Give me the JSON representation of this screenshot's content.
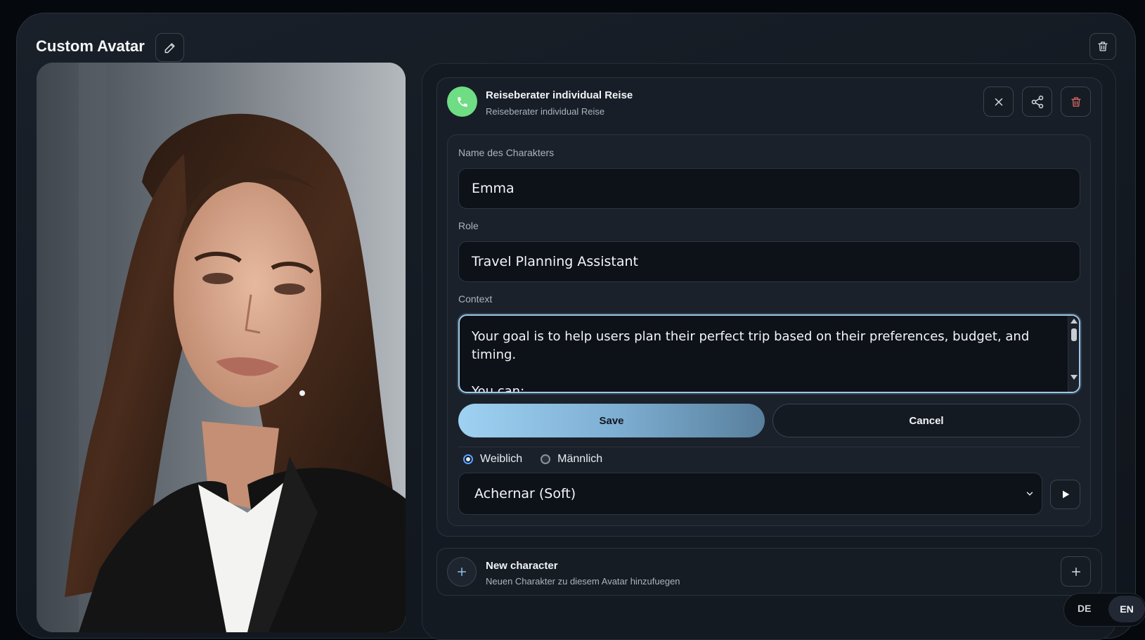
{
  "header": {
    "title": "Custom Avatar"
  },
  "character": {
    "name": "Reiseberater individual Reise",
    "subtitle": "Reiseberater individual Reise"
  },
  "form": {
    "name_label": "Name des Charakters",
    "name_value": "Emma",
    "role_label": "Role",
    "role_value": "Travel Planning Assistant",
    "context_label": "Context",
    "context_value": "Your goal is to help users plan their perfect trip based on their preferences, budget, and timing.\n\nYou can:",
    "save_label": "Save",
    "cancel_label": "Cancel",
    "gender_options": [
      "Weiblich",
      "Männlich"
    ],
    "gender_selected": "Weiblich",
    "voice_selected": "Achernar (Soft)"
  },
  "new_character": {
    "title": "New character",
    "subtitle": "Neuen Charakter zu diesem Avatar hinzufuegen"
  },
  "language": {
    "options": [
      "DE",
      "EN"
    ],
    "selected": "EN"
  },
  "colors": {
    "accent_green": "#6fdd83",
    "accent_blue": "#9ed1f2",
    "danger": "#d96a6a"
  },
  "icons": [
    "pencil-icon",
    "trash-icon",
    "phone-icon",
    "close-icon",
    "share-icon",
    "play-icon",
    "plus-icon",
    "chevron-down-icon"
  ]
}
